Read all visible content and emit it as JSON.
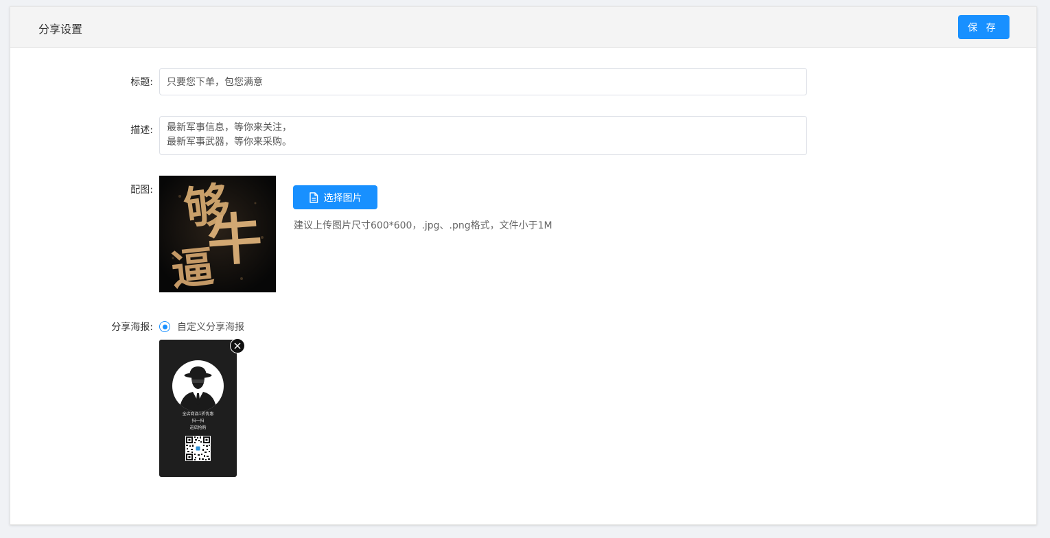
{
  "header": {
    "title": "分享设置",
    "save_label": "保 存"
  },
  "form": {
    "title_label": "标题:",
    "title_value": "只要您下单，包您满意",
    "desc_label": "描述:",
    "desc_value": "最新军事信息，等你来关注，\n最新军事武器，等你来采购。",
    "image_label": "配图:",
    "cover_text": [
      "够",
      "牛",
      "逼"
    ],
    "choose_image_label": "选择图片",
    "image_hint": "建议上传图片尺寸600*600，.jpg、.png格式，文件小于1M",
    "poster_label": "分享海报:",
    "poster_option_label": "自定义分享海报",
    "poster_option_selected": true
  },
  "poster": {
    "line1": "全店商品1折优惠",
    "line2": "扫一扫",
    "line3": "进店抢购"
  },
  "colors": {
    "accent": "#1890ff",
    "header_bg": "#f4f4f4",
    "poster_bg": "#1e1e1e",
    "cover_gold": "#c9a06a"
  }
}
